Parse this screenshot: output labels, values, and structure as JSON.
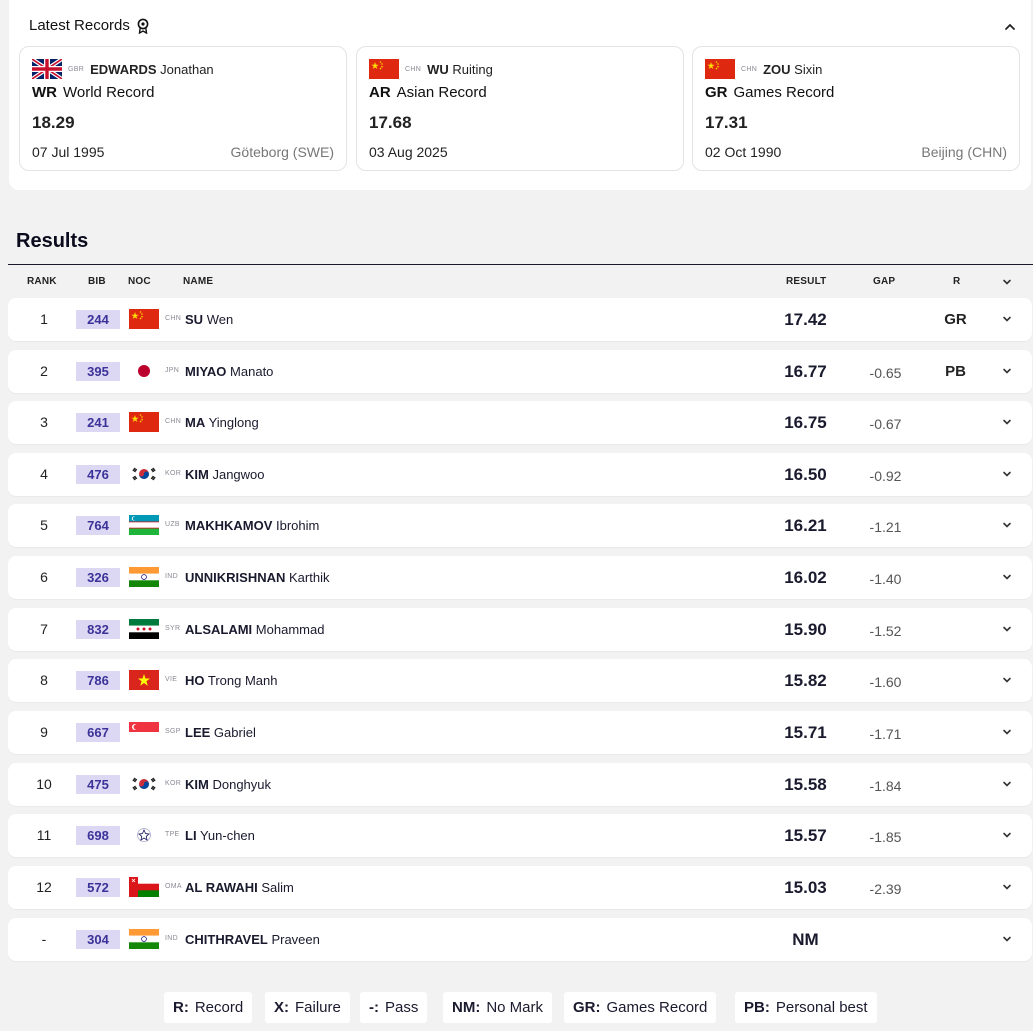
{
  "latest_records": {
    "title": "Latest Records",
    "items": [
      {
        "noc": "GBR",
        "surname": "EDWARDS",
        "given": "Jonathan",
        "abbr": "WR",
        "type": "World Record",
        "value": "18.29",
        "date": "07 Jul 1995",
        "venue": "Göteborg (SWE)",
        "flag": "gbr"
      },
      {
        "noc": "CHN",
        "surname": "WU",
        "given": "Ruiting",
        "abbr": "AR",
        "type": "Asian Record",
        "value": "17.68",
        "date": "03 Aug 2025",
        "venue": "",
        "flag": "chn"
      },
      {
        "noc": "CHN",
        "surname": "ZOU",
        "given": "Sixin",
        "abbr": "GR",
        "type": "Games Record",
        "value": "17.31",
        "date": "02 Oct 1990",
        "venue": "Beijing (CHN)",
        "flag": "chn"
      }
    ]
  },
  "results": {
    "title": "Results",
    "columns": {
      "rank": "RANK",
      "bib": "BIB",
      "noc": "NOC",
      "name": "NAME",
      "result": "RESULT",
      "gap": "GAP",
      "r": "R"
    },
    "rows": [
      {
        "rank": "1",
        "bib": "244",
        "noc": "CHN",
        "surname": "SU",
        "given": "Wen",
        "result": "17.42",
        "gap": "",
        "r": "GR",
        "flag": "chn"
      },
      {
        "rank": "2",
        "bib": "395",
        "noc": "JPN",
        "surname": "MIYAO",
        "given": "Manato",
        "result": "16.77",
        "gap": "-0.65",
        "r": "PB",
        "flag": "jpn"
      },
      {
        "rank": "3",
        "bib": "241",
        "noc": "CHN",
        "surname": "MA",
        "given": "Yinglong",
        "result": "16.75",
        "gap": "-0.67",
        "r": "",
        "flag": "chn"
      },
      {
        "rank": "4",
        "bib": "476",
        "noc": "KOR",
        "surname": "KIM",
        "given": "Jangwoo",
        "result": "16.50",
        "gap": "-0.92",
        "r": "",
        "flag": "kor"
      },
      {
        "rank": "5",
        "bib": "764",
        "noc": "UZB",
        "surname": "MAKHKAMOV",
        "given": "Ibrohim",
        "result": "16.21",
        "gap": "-1.21",
        "r": "",
        "flag": "uzb"
      },
      {
        "rank": "6",
        "bib": "326",
        "noc": "IND",
        "surname": "UNNIKRISHNAN",
        "given": "Karthik",
        "result": "16.02",
        "gap": "-1.40",
        "r": "",
        "flag": "ind"
      },
      {
        "rank": "7",
        "bib": "832",
        "noc": "SYR",
        "surname": "ALSALAMI",
        "given": "Mohammad",
        "result": "15.90",
        "gap": "-1.52",
        "r": "",
        "flag": "syr"
      },
      {
        "rank": "8",
        "bib": "786",
        "noc": "VIE",
        "surname": "HO",
        "given": "Trong Manh",
        "result": "15.82",
        "gap": "-1.60",
        "r": "",
        "flag": "vie"
      },
      {
        "rank": "9",
        "bib": "667",
        "noc": "SGP",
        "surname": "LEE",
        "given": "Gabriel",
        "result": "15.71",
        "gap": "-1.71",
        "r": "",
        "flag": "sgp"
      },
      {
        "rank": "10",
        "bib": "475",
        "noc": "KOR",
        "surname": "KIM",
        "given": "Donghyuk",
        "result": "15.58",
        "gap": "-1.84",
        "r": "",
        "flag": "kor"
      },
      {
        "rank": "11",
        "bib": "698",
        "noc": "TPE",
        "surname": "LI",
        "given": "Yun-chen",
        "result": "15.57",
        "gap": "-1.85",
        "r": "",
        "flag": "tpe"
      },
      {
        "rank": "12",
        "bib": "572",
        "noc": "OMA",
        "surname": "AL RAWAHI",
        "given": "Salim",
        "result": "15.03",
        "gap": "-2.39",
        "r": "",
        "flag": "oma"
      },
      {
        "rank": "-",
        "bib": "304",
        "noc": "IND",
        "surname": "CHITHRAVEL",
        "given": "Praveen",
        "result": "NM",
        "gap": "",
        "r": "",
        "flag": "ind"
      }
    ]
  },
  "legend": [
    {
      "abbr": "R:",
      "label": "Record"
    },
    {
      "abbr": "X:",
      "label": "Failure"
    },
    {
      "abbr": "-:",
      "label": "Pass"
    },
    {
      "abbr": "NM:",
      "label": "No Mark"
    },
    {
      "abbr": "GR:",
      "label": "Games Record"
    },
    {
      "abbr": "PB:",
      "label": "Personal best"
    }
  ],
  "icons": {
    "records": "award-ribbon-icon",
    "collapse": "chevron-up-icon",
    "expand": "chevron-down-icon"
  },
  "colors": {
    "bib_bg": "#dcd7f2",
    "bib_text": "#3b3399",
    "page_bg": "#f2f2f2"
  }
}
